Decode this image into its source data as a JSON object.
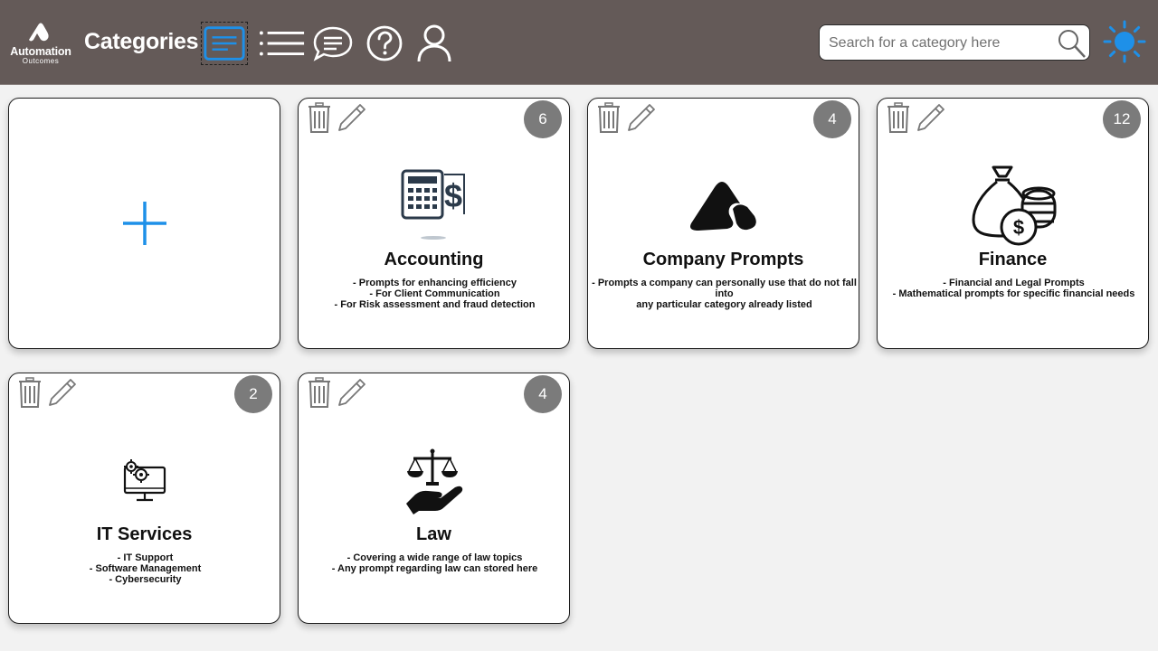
{
  "header": {
    "brand_name": "Automation",
    "brand_sub": "Outcomes",
    "title": "Categories",
    "search_placeholder": "Search for a category here",
    "nav_icons": [
      "tile-view-icon",
      "list-view-icon",
      "chat-icon",
      "help-icon",
      "user-icon"
    ],
    "theme_icon": "sun-icon",
    "accent_color": "#1e90e8",
    "header_color": "#645a58"
  },
  "add_card": {
    "icon": "plus-icon"
  },
  "categories": [
    {
      "title": "Accounting",
      "count": "6",
      "icon": "calculator-dollar-icon",
      "lines": [
        "- Prompts for enhancing efficiency",
        "- For Client Communication",
        "- For Risk assessment and fraud detection"
      ]
    },
    {
      "title": "Company Prompts",
      "count": "4",
      "icon": "company-logo-icon",
      "lines": [
        "- Prompts a company can personally use that do not fall into",
        "any particular category already listed"
      ]
    },
    {
      "title": "Finance",
      "count": "12",
      "icon": "money-bag-coins-icon",
      "lines": [
        "- Financial and Legal Prompts",
        "- Mathematical prompts for specific financial needs"
      ]
    },
    {
      "title": "IT Services",
      "count": "2",
      "icon": "computer-gears-icon",
      "lines": [
        "- IT Support",
        "- Software Management",
        "- Cybersecurity"
      ]
    },
    {
      "title": "Law",
      "count": "4",
      "icon": "scales-hand-icon",
      "lines": [
        "- Covering a wide range of law topics",
        "- Any prompt regarding law can stored here"
      ]
    }
  ]
}
